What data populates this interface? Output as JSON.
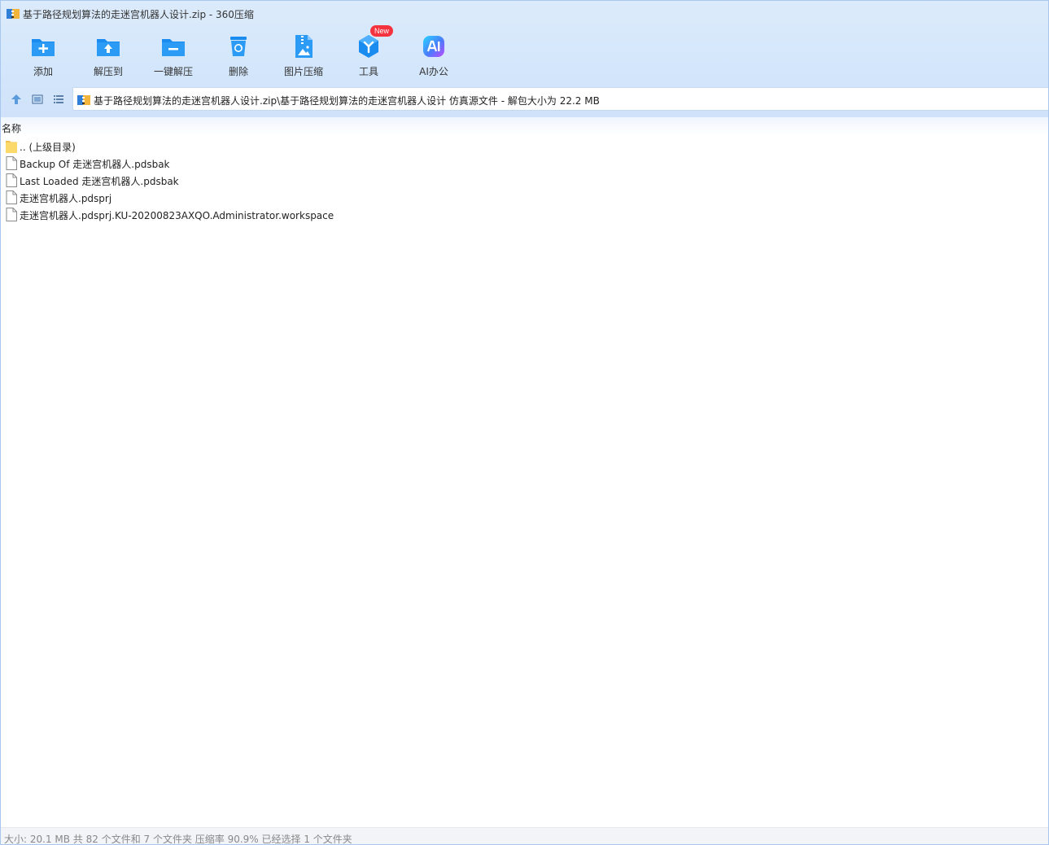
{
  "window": {
    "title": "基于路径规划算法的走迷宫机器人设计.zip - 360压缩"
  },
  "toolbar": {
    "items": [
      {
        "label": "添加",
        "icon": "add-folder-icon"
      },
      {
        "label": "解压到",
        "icon": "extract-to-icon"
      },
      {
        "label": "一键解压",
        "icon": "one-click-extract-icon"
      },
      {
        "label": "删除",
        "icon": "trash-icon"
      },
      {
        "label": "图片压缩",
        "icon": "image-compress-icon"
      },
      {
        "label": "工具",
        "icon": "tools-icon"
      },
      {
        "label": "AI办公",
        "icon": "ai-office-icon"
      }
    ],
    "new_badge": "New"
  },
  "path": {
    "text": "基于路径规划算法的走迷宫机器人设计.zip\\基于路径规划算法的走迷宫机器人设计 仿真源文件 - 解包大小为 22.2 MB"
  },
  "file_list": {
    "column_name": "名称",
    "rows": [
      {
        "name": ".. (上级目录)",
        "type": "folder"
      },
      {
        "name": "Backup Of 走迷宫机器人.pdsbak",
        "type": "file"
      },
      {
        "name": "Last Loaded 走迷宫机器人.pdsbak",
        "type": "file"
      },
      {
        "name": "走迷宫机器人.pdsprj",
        "type": "file"
      },
      {
        "name": "走迷宫机器人.pdsprj.KU-20200823AXQO.Administrator.workspace",
        "type": "file"
      }
    ]
  },
  "status": {
    "text": "大小: 20.1 MB 共 82 个文件和 7 个文件夹 压缩率 90.9% 已经选择 1 个文件夹"
  },
  "colors": {
    "accent_blue": "#1a8cf0",
    "badge_red": "#f5333f",
    "topbar_bg": "#d6e7fb"
  }
}
